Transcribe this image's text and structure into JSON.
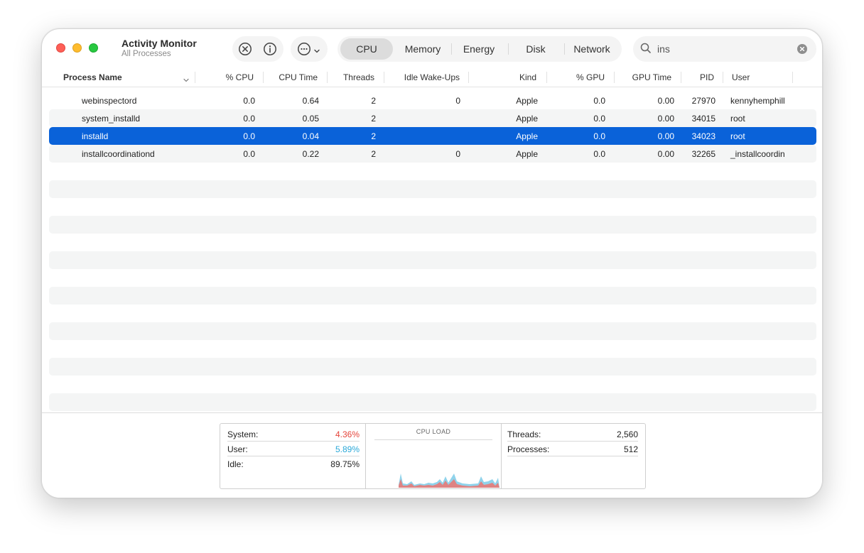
{
  "app": {
    "title": "Activity Monitor",
    "subtitle": "All Processes"
  },
  "toolbar": {
    "stop_icon": "stop-process-icon",
    "info_icon": "info-icon",
    "more_icon": "ellipsis-circle-icon"
  },
  "tabs": [
    {
      "label": "CPU",
      "active": true
    },
    {
      "label": "Memory",
      "active": false
    },
    {
      "label": "Energy",
      "active": false
    },
    {
      "label": "Disk",
      "active": false
    },
    {
      "label": "Network",
      "active": false
    }
  ],
  "search": {
    "value": "ins"
  },
  "columns": {
    "name": "Process Name",
    "cpu": "% CPU",
    "cpu_time": "CPU Time",
    "threads": "Threads",
    "idle_wake": "Idle Wake-Ups",
    "kind": "Kind",
    "gpu": "% GPU",
    "gpu_time": "GPU Time",
    "pid": "PID",
    "user": "User"
  },
  "processes": [
    {
      "name": "webinspectord",
      "cpu": "0.0",
      "cpu_time": "0.64",
      "threads": "2",
      "idle_wake": "0",
      "kind": "Apple",
      "gpu": "0.0",
      "gpu_time": "0.00",
      "pid": "27970",
      "user": "kennyhemphill"
    },
    {
      "name": "system_installd",
      "cpu": "0.0",
      "cpu_time": "0.05",
      "threads": "2",
      "idle_wake": "",
      "kind": "Apple",
      "gpu": "0.0",
      "gpu_time": "0.00",
      "pid": "34015",
      "user": "root"
    },
    {
      "name": "installd",
      "cpu": "0.0",
      "cpu_time": "0.04",
      "threads": "2",
      "idle_wake": "",
      "kind": "Apple",
      "gpu": "0.0",
      "gpu_time": "0.00",
      "pid": "34023",
      "user": "root"
    },
    {
      "name": "installcoordinationd",
      "cpu": "0.0",
      "cpu_time": "0.22",
      "threads": "2",
      "idle_wake": "0",
      "kind": "Apple",
      "gpu": "0.0",
      "gpu_time": "0.00",
      "pid": "32265",
      "user": "_installcoordin"
    }
  ],
  "footer": {
    "system_label": "System:",
    "system_value": "4.36%",
    "system_color": "#e5443a",
    "user_label": "User:",
    "user_value": "5.89%",
    "user_color": "#2aa8d8",
    "idle_label": "Idle:",
    "idle_value": "89.75%",
    "graph_title": "CPU LOAD",
    "threads_label": "Threads:",
    "threads_value": "2,560",
    "processes_label": "Processes:",
    "processes_value": "512"
  }
}
